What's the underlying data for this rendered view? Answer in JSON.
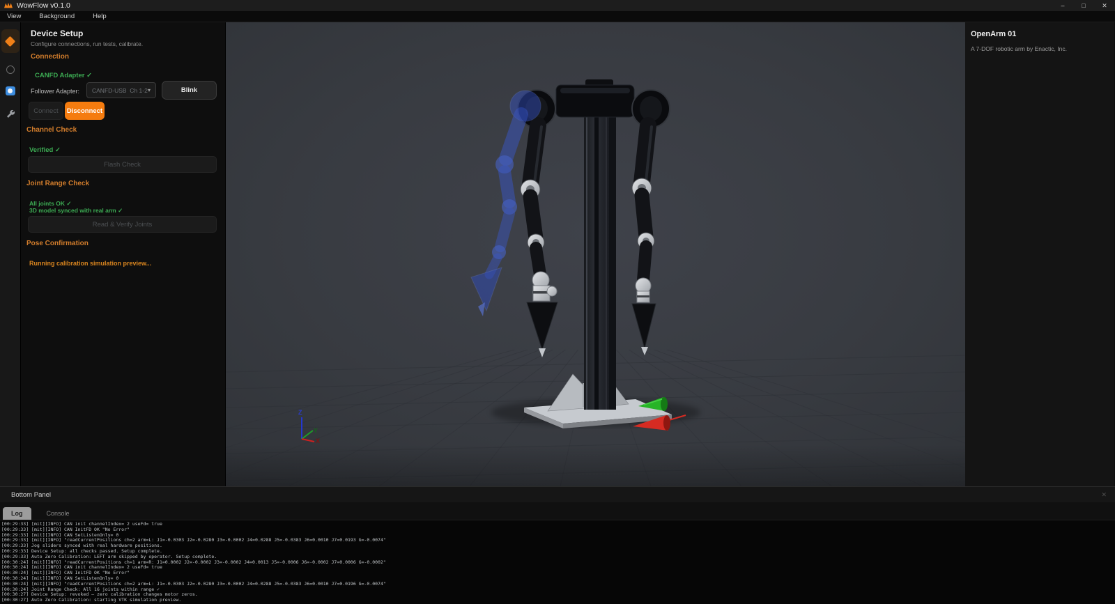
{
  "titlebar": {
    "app_title": "WowFlow v0.1.0",
    "minimize_glyph": "–",
    "maximize_glyph": "□",
    "close_glyph": "✕"
  },
  "menubar": {
    "items": [
      "View",
      "Background",
      "Help"
    ]
  },
  "device_setup": {
    "title": "Device Setup",
    "subtitle": "Configure connections, run tests, calibrate.",
    "connection": {
      "header": "Connection",
      "status": "CANFD Adapter ✓",
      "follower_label": "Follower Adapter:",
      "adapter_value": "CANFD-USB  Ch 1-2",
      "chevron_glyph": "▾",
      "blink_label": "Blink",
      "connect_label": "Connect",
      "disconnect_label": "Disconnect"
    },
    "channel_check": {
      "header": "Channel Check",
      "status": "Verified ✓",
      "button_label": "Flash Check"
    },
    "joint_range": {
      "header": "Joint Range Check",
      "status1": "All joints OK ✓",
      "status2": "3D model synced with real arm ✓",
      "button_label": "Read & Verify Joints"
    },
    "pose": {
      "header": "Pose Confirmation",
      "status": "Running calibration simulation preview..."
    }
  },
  "viewport": {
    "axis_labels": {
      "z": "Z",
      "y": "Y",
      "x": "X"
    }
  },
  "info_panel": {
    "title": "OpenArm 01",
    "subtitle": "A 7-DOF robotic arm by Enactic, Inc."
  },
  "bottom_panel": {
    "title": "Bottom Panel",
    "close_glyph": "✕",
    "tabs": [
      {
        "label": "Log"
      },
      {
        "label": "Console"
      }
    ],
    "log_lines": [
      "[00:29:33] [mit][INFO] CAN init channelIndex= 2 useFd= true",
      "[00:29:33] [mit][INFO] CAN InitFD OK \"No Error\"",
      "[00:29:33] [mit][INFO] CAN SetListenOnly= 0",
      "[00:29:33] [mit][INFO] \"readCurrentPositions ch=2 arm=L: J1=-0.0303 J2=-0.0280 J3=-0.0002 J4=0.0288 J5=-0.0383 J6=0.0010 J7=0.0193 G=-0.0074\"",
      "[00:29:33] Jog sliders synced with real hardware positions.",
      "[00:29:33] Device Setup: all checks passed. Setup complete.",
      "[00:29:33] Auto Zero Calibration: LEFT arm skipped by operator. Setup complete.",
      "[00:30:24] [mit][INFO] \"readCurrentPositions ch=1 arm=R: J1=0.0002 J2=-0.0002 J3=-0.0002 J4=0.0013 J5=-0.0006 J6=-0.0002 J7=0.0006 G=-0.0002\"",
      "[00:30:24] [mit][INFO] CAN init channelIndex= 2 useFd= true",
      "[00:30:24] [mit][INFO] CAN InitFD OK \"No Error\"",
      "[00:30:24] [mit][INFO] CAN SetListenOnly= 0",
      "[00:30:24] [mit][INFO] \"readCurrentPositions ch=2 arm=L: J1=-0.0303 J2=-0.0280 J3=-0.0002 J4=0.0288 J5=-0.0383 J6=0.0010 J7=0.0196 G=-0.0074\"",
      "[00:30:24] Joint Range Check: All 16 joints within range ✓",
      "[00:30:27] Device Setup: revoked — zero calibration changes motor zeros.",
      "[00:30:27] Auto Zero Calibration: starting VTK simulation preview."
    ]
  },
  "colors": {
    "accent_orange": "#f57c0f",
    "section_orange": "#d27d2c",
    "status_green": "#3cab53",
    "warn_amber": "#d9851f",
    "ghost_blue": "#3b63e0",
    "marker_green": "#27b427",
    "marker_red": "#d62b22"
  }
}
